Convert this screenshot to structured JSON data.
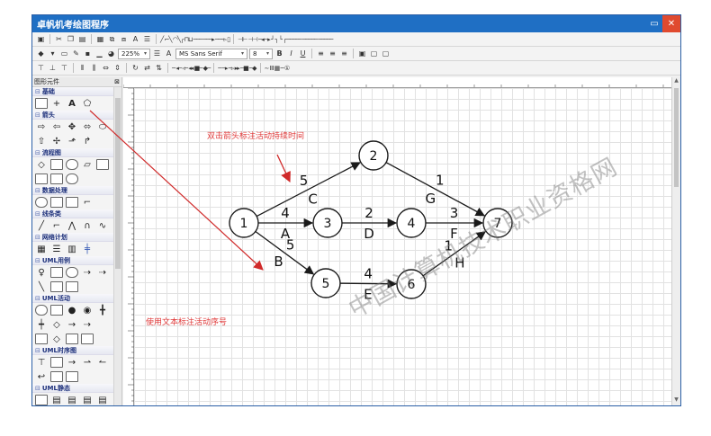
{
  "window": {
    "title": "卓帆机考绘图程序",
    "minimize": "▭",
    "close": "✕"
  },
  "toolbar": {
    "zoom": "225%",
    "font_family": "MS Sans Serif",
    "font_size": "8",
    "bold": "B",
    "italic": "I",
    "underline": "U",
    "text_a": "A"
  },
  "sidebar": {
    "title": "图形元件",
    "categories": [
      "基础",
      "箭头",
      "流程图",
      "数据处理",
      "线条类",
      "网络计划",
      "UML用例",
      "UML活动",
      "UML时序图",
      "UML静态"
    ]
  },
  "diagram": {
    "nodes": [
      "1",
      "2",
      "3",
      "4",
      "5",
      "6",
      "7"
    ],
    "edges": [
      {
        "from": "1",
        "to": "2",
        "duration": "5",
        "activity": "C"
      },
      {
        "from": "1",
        "to": "3",
        "duration": "4",
        "activity": "A"
      },
      {
        "from": "1",
        "to": "5",
        "duration": "5",
        "activity": "B"
      },
      {
        "from": "3",
        "to": "4",
        "duration": "2",
        "activity": "D"
      },
      {
        "from": "4",
        "to": "7",
        "duration": "3",
        "activity": "F"
      },
      {
        "from": "2",
        "to": "7",
        "duration": "1",
        "activity": "G"
      },
      {
        "from": "5",
        "to": "6",
        "duration": "4",
        "activity": "E"
      },
      {
        "from": "6",
        "to": "7",
        "duration": "1",
        "activity": "H"
      }
    ]
  },
  "annotations": {
    "arrow_note": "双击箭头标注活动持续时间",
    "text_note": "使用文本标注活动序号"
  },
  "watermark": "中国计算机技术职业资格网",
  "colors": {
    "titlebar": "#1f6fc4",
    "close": "#e04a2f",
    "annotation": "#e03a3a"
  }
}
